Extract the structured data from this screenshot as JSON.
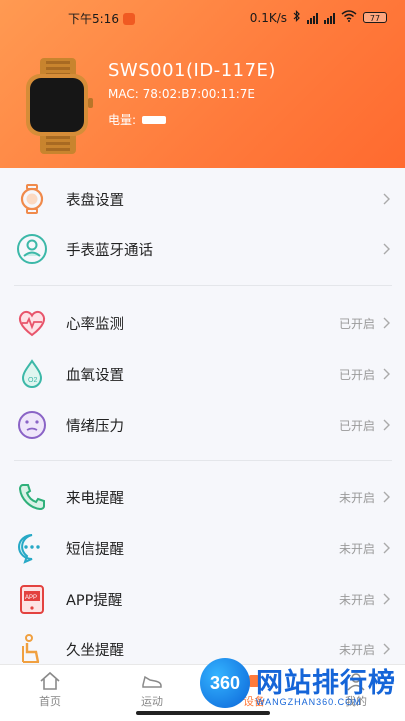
{
  "status_bar": {
    "time": "下午5:16",
    "network_speed": "0.1K/s",
    "battery_level": "77"
  },
  "device": {
    "name": "SWS001(ID-117E)",
    "mac": "MAC: 78:02:B7:00:11:7E",
    "battery_label": "电量:"
  },
  "sections": [
    [
      {
        "label": "表盘设置",
        "status": "",
        "icon": "watch-face-icon"
      },
      {
        "label": "手表蓝牙通话",
        "status": "",
        "icon": "bluetooth-call-icon"
      }
    ],
    [
      {
        "label": "心率监测",
        "status": "已开启",
        "icon": "heart-rate-icon"
      },
      {
        "label": "血氧设置",
        "status": "已开启",
        "icon": "blood-oxygen-icon"
      },
      {
        "label": "情绪压力",
        "status": "已开启",
        "icon": "mood-stress-icon"
      }
    ],
    [
      {
        "label": "来电提醒",
        "status": "未开启",
        "icon": "phone-icon"
      },
      {
        "label": "短信提醒",
        "status": "未开启",
        "icon": "sms-icon"
      },
      {
        "label": "APP提醒",
        "status": "未开启",
        "icon": "app-icon"
      },
      {
        "label": "久坐提醒",
        "status": "未开启",
        "icon": "sedentary-icon"
      }
    ]
  ],
  "tabs": {
    "home": "首页",
    "sport": "运动",
    "device": "设备",
    "mine": "我的"
  },
  "watermark": {
    "logo": "360",
    "title": "网站排行榜",
    "subtitle": "WANGZHAN360.COM"
  },
  "colors": {
    "header_start": "#ff9a52",
    "header_end": "#ff6a2f",
    "icon_orange": "#f08a4b",
    "icon_teal": "#3cb8a8",
    "icon_red": "#e8556b",
    "icon_purple": "#8a63c6"
  }
}
